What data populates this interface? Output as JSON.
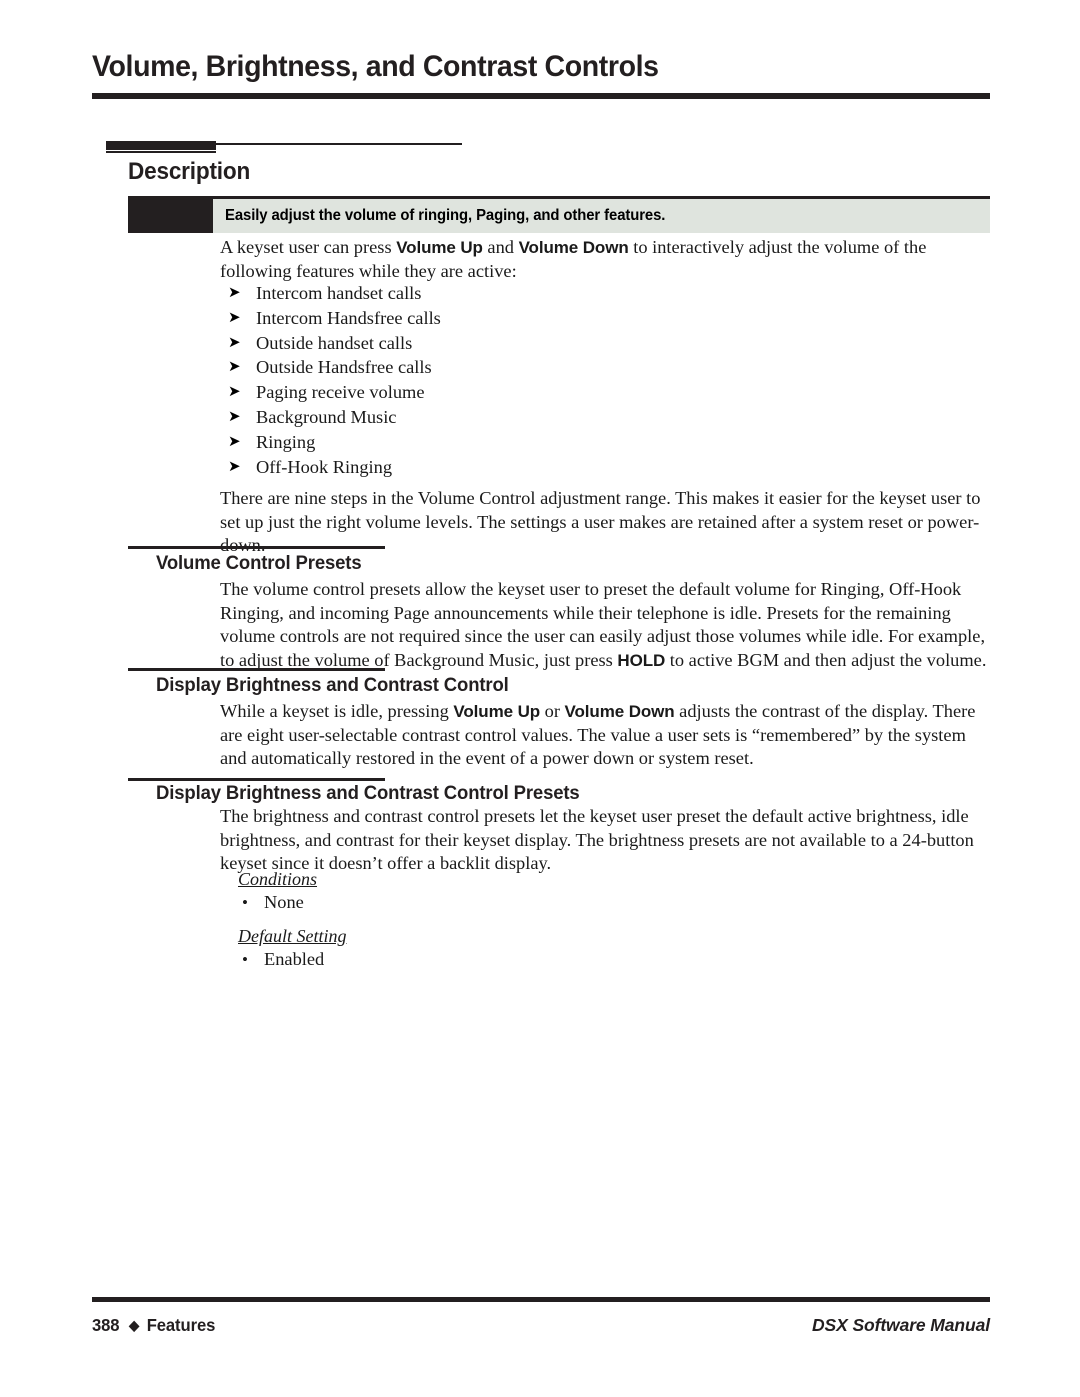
{
  "page": {
    "title": "Volume, Brightness, and Contrast Controls",
    "section_heading": "Description",
    "callout": "Easily adjust the volume of ringing, Paging, and other features.",
    "bullet_glyph": "➤",
    "dot_glyph": "•",
    "footer_divider_glyph": "◆"
  },
  "intro": {
    "line1_pre": "A keyset user can press ",
    "bold1": "Volume Up",
    "mid1": " and ",
    "bold2": "Volume Down",
    "post": " to interactively adjust the volume of the following features while they are active:"
  },
  "feature_list": [
    "Intercom handset calls",
    "Intercom Handsfree calls",
    "Outside handset calls",
    "Outside Handsfree calls",
    "Paging receive volume",
    "Background Music",
    "Ringing",
    "Off-Hook Ringing"
  ],
  "steps_paragraph": "There are nine steps in the Volume Control adjustment range. This makes it easier for the keyset user to set up just the right volume levels. The settings a user makes are retained after a system reset or power-down.",
  "subsections": [
    {
      "heading": "Volume Control Presets",
      "text_pre": "The volume control presets allow the keyset user to preset the default volume for Ringing, Off-Hook Ringing, and incoming Page announcements while their telephone is idle. Presets for the remaining volume controls are not required since the user can easily adjust those volumes while idle. For example, to adjust the volume of Background Music, just press ",
      "bold": "HOLD",
      "text_post": " to active BGM and then adjust the volume."
    },
    {
      "heading": "Display Brightness and Contrast Control",
      "text_pre": "While a keyset is idle, pressing ",
      "bold": "Volume Up",
      "text_mid": " or ",
      "bold2": "Volume Down",
      "text_post": " adjusts the contrast of the display. There are eight user-selectable contrast control values. The value a user sets is “remembered” by the system and automatically restored in the event of a power down or system reset."
    },
    {
      "heading": "Display Brightness and Contrast Control Presets",
      "text": "The brightness and contrast control presets let the keyset user preset the default active brightness, idle brightness, and contrast for their keyset display. The brightness presets are not available to a 24-button keyset since it doesn’t offer a backlit display."
    }
  ],
  "meta": {
    "conditions_label": "Conditions",
    "conditions_value": "None",
    "default_label": "Default Setting",
    "default_value": "Enabled"
  },
  "footer": {
    "page_number": "388",
    "section_name": "Features",
    "manual_name": "DSX Software Manual"
  },
  "colors": {
    "ink": "#231f20",
    "banner_bg": "#dfe4de",
    "banner_square": "#231f20"
  }
}
